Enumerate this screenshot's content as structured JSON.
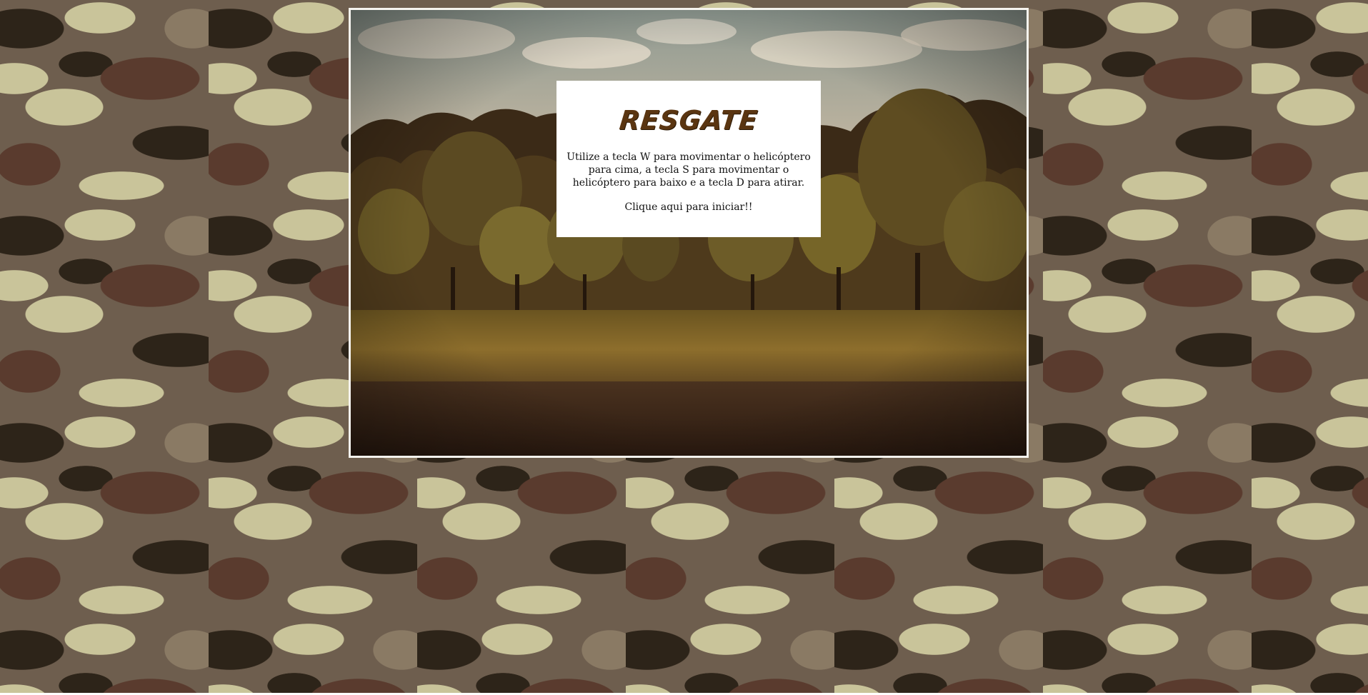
{
  "game": {
    "title": "RESGATE",
    "instructions": "Utilize a tecla W para movimentar o helicóptero para cima, a tecla S para movimentar o helicóptero para baixo e a tecla D para atirar.",
    "start_text": "Clique aqui para iniciar!!"
  },
  "colors": {
    "title": "#5a3511",
    "panel_background": "#ffffff",
    "frame_border": "#f5f3ee",
    "camo_dark": "#2d2419",
    "camo_brown": "#5a3b2e",
    "camo_mid": "#6e5e4e",
    "camo_light": "#c9c49a"
  },
  "icons": {
    "background": "camouflage-pattern",
    "scene": "forest-meadow-image"
  }
}
